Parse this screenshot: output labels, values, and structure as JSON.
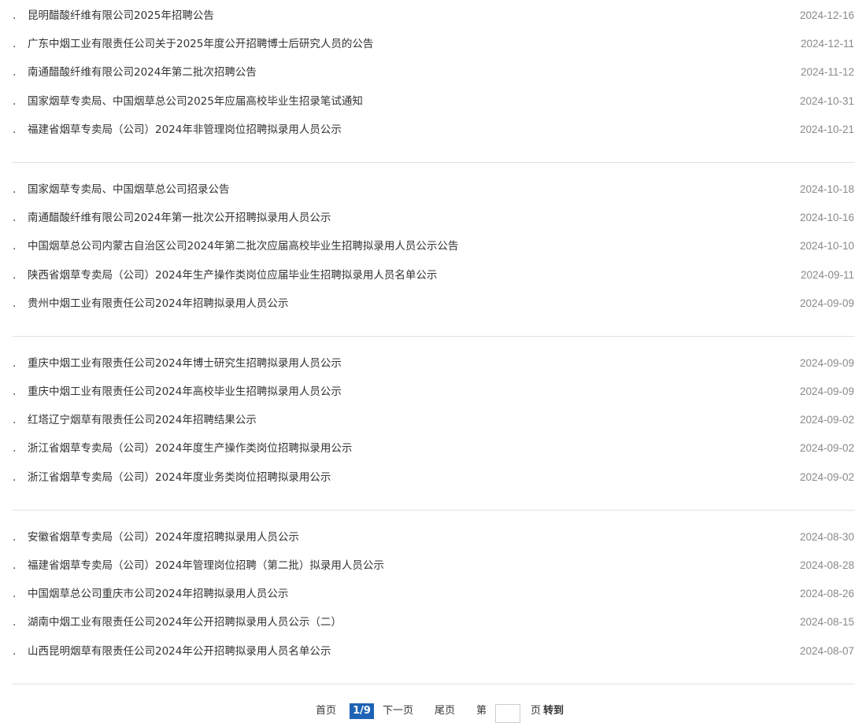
{
  "groups": [
    [
      {
        "title": "昆明醋酸纤维有限公司2025年招聘公告",
        "date": "2024-12-16"
      },
      {
        "title": "广东中烟工业有限责任公司关于2025年度公开招聘博士后研究人员的公告",
        "date": "2024-12-11"
      },
      {
        "title": "南通醋酸纤维有限公司2024年第二批次招聘公告",
        "date": "2024-11-12"
      },
      {
        "title": "国家烟草专卖局、中国烟草总公司2025年应届高校毕业生招录笔试通知",
        "date": "2024-10-31"
      },
      {
        "title": "福建省烟草专卖局（公司）2024年非管理岗位招聘拟录用人员公示",
        "date": "2024-10-21"
      }
    ],
    [
      {
        "title": "国家烟草专卖局、中国烟草总公司招录公告",
        "date": "2024-10-18"
      },
      {
        "title": "南通醋酸纤维有限公司2024年第一批次公开招聘拟录用人员公示",
        "date": "2024-10-16"
      },
      {
        "title": "中国烟草总公司内蒙古自治区公司2024年第二批次应届高校毕业生招聘拟录用人员公示公告",
        "date": "2024-10-10"
      },
      {
        "title": "陕西省烟草专卖局（公司）2024年生产操作类岗位应届毕业生招聘拟录用人员名单公示",
        "date": "2024-09-11"
      },
      {
        "title": "贵州中烟工业有限责任公司2024年招聘拟录用人员公示",
        "date": "2024-09-09"
      }
    ],
    [
      {
        "title": "重庆中烟工业有限责任公司2024年博士研究生招聘拟录用人员公示",
        "date": "2024-09-09"
      },
      {
        "title": "重庆中烟工业有限责任公司2024年高校毕业生招聘拟录用人员公示",
        "date": "2024-09-09"
      },
      {
        "title": "红塔辽宁烟草有限责任公司2024年招聘结果公示",
        "date": "2024-09-02"
      },
      {
        "title": "浙江省烟草专卖局（公司）2024年度生产操作类岗位招聘拟录用公示",
        "date": "2024-09-02"
      },
      {
        "title": "浙江省烟草专卖局（公司）2024年度业务类岗位招聘拟录用公示",
        "date": "2024-09-02"
      }
    ],
    [
      {
        "title": "安徽省烟草专卖局（公司）2024年度招聘拟录用人员公示",
        "date": "2024-08-30"
      },
      {
        "title": "福建省烟草专卖局（公司）2024年管理岗位招聘（第二批）拟录用人员公示",
        "date": "2024-08-28"
      },
      {
        "title": "中国烟草总公司重庆市公司2024年招聘拟录用人员公示",
        "date": "2024-08-26"
      },
      {
        "title": "湖南中烟工业有限责任公司2024年公开招聘拟录用人员公示（二）",
        "date": "2024-08-15"
      },
      {
        "title": "山西昆明烟草有限责任公司2024年公开招聘拟录用人员名单公示",
        "date": "2024-08-07"
      }
    ]
  ],
  "bullet": ".",
  "pagination": {
    "first": "首页",
    "current": "1/9",
    "next": "下一页",
    "last": "尾页",
    "goto_prefix": "第",
    "goto_suffix": "页",
    "goto_button": "转到",
    "input_value": ""
  },
  "colors": {
    "accent": "#1e63b5",
    "title_text": "#333333",
    "date_text": "#8a8a8a",
    "divider": "#e2e2e2"
  }
}
